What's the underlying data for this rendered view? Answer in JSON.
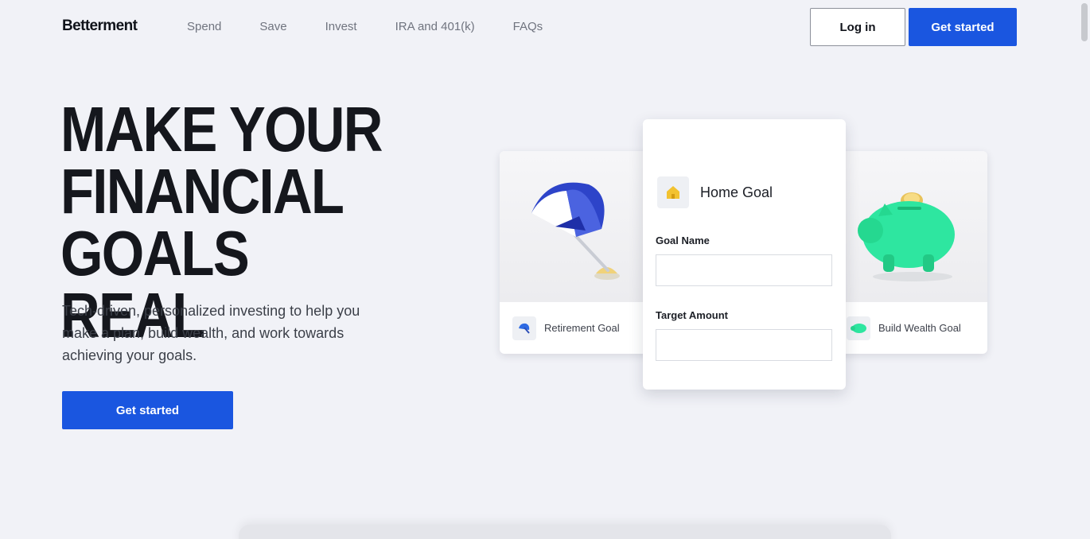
{
  "brand": {
    "name": "Betterment",
    "accent_color": "#1a56e0"
  },
  "nav": {
    "links": [
      "Spend",
      "Save",
      "Invest",
      "IRA and 401(k)",
      "FAQs"
    ],
    "login_label": "Log in",
    "get_started_label": "Get started"
  },
  "hero": {
    "title_lines": [
      "MAKE YOUR",
      "FINANCIAL",
      "GOALS REAL"
    ],
    "subtitle": "Tech-driven, personalized investing to help you make a plan, build wealth, and work towards achieving your goals.",
    "cta_label": "Get started"
  },
  "goal_cards": {
    "retirement": {
      "label": "Retirement Goal",
      "icon": "umbrella-icon"
    },
    "home": {
      "title": "Home Goal",
      "icon": "house-icon",
      "goal_name_label": "Goal Name",
      "goal_name_value": "",
      "target_amount_label": "Target Amount",
      "target_amount_value": ""
    },
    "wealth": {
      "label": "Build Wealth Goal",
      "icon": "piggy-bank-icon"
    }
  }
}
